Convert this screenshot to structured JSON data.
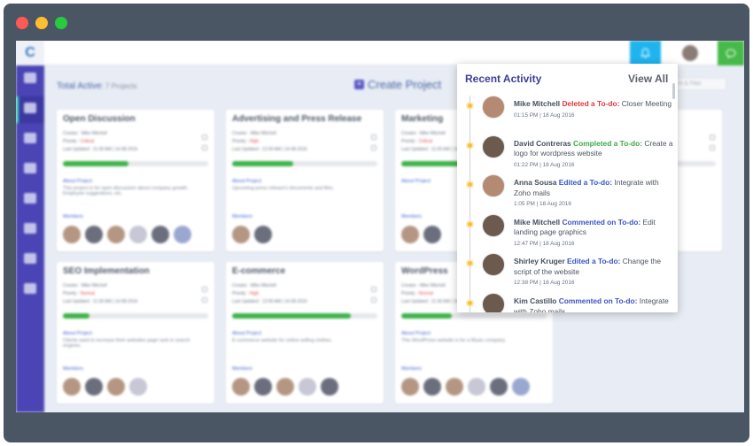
{
  "app": {
    "logo_text": "C",
    "subheading": "Total Active",
    "subcount": ": 7 Projects",
    "create_label": "Create Project",
    "search_placeholder": "Search & Filter"
  },
  "colors": {
    "sidebar": "#4a44b4",
    "accent_blue": "#1fb4ee",
    "accent_green": "#47b94a",
    "progress": "#3fb34a",
    "activity_title": "#3f3d9a",
    "deleted": "#e0383e",
    "completed": "#3da94d",
    "action": "#3a55c7"
  },
  "icons": {
    "bell": "bell-icon",
    "chat": "chat-icon",
    "sidebar": [
      "home-icon",
      "tasks-icon",
      "calendar-icon",
      "cloud-icon",
      "docs-icon",
      "shield-icon",
      "share-icon",
      "card-icon"
    ]
  },
  "cards": [
    {
      "title": "Open Discussion",
      "creator": "Creator : Mike Mitchell",
      "priority_label": "Priority :",
      "priority": "Critical",
      "updated": "Last Updated : 11:30 AM | 14-08-2016",
      "progress": 0.45,
      "about": "About Project",
      "desc": "This project is for open discussion about company growth. Employee suggestions, etc.",
      "members": "Members",
      "member_count": 6
    },
    {
      "title": "Advertising and Press Release",
      "creator": "Creator : Mike Mitchell",
      "priority_label": "Priority :",
      "priority": "High",
      "updated": "Last Updated : 12:00 AM | 14-08-2016",
      "progress": 0.42,
      "about": "About Project",
      "desc": "Upcoming press release's documents and files.",
      "members": "Members",
      "member_count": 2
    },
    {
      "title": "Marketing",
      "creator": "Creator : Mike Mitchell",
      "priority_label": "Priority :",
      "priority": "Critical",
      "updated": "Last Updated : 11:00 AM | 14-08-2016",
      "progress": 0.45,
      "about": "About Project",
      "desc": "",
      "members": "Members",
      "member_count": 2
    },
    {
      "title": "",
      "creator": "",
      "priority_label": "",
      "priority": "",
      "updated": "",
      "progress": 0.5,
      "about": "",
      "desc": "",
      "members": "",
      "member_count": 2
    },
    {
      "title": "SEO Implementation",
      "creator": "Creator : Mike Mitchell",
      "priority_label": "Priority :",
      "priority": "Normal",
      "updated": "Last Updated : 11:30 AM | 14-08-2016",
      "progress": 0.18,
      "about": "About Project",
      "desc": "Clients want to increase their websites page rank in search engines.",
      "members": "Members",
      "member_count": 4
    },
    {
      "title": "E-commerce",
      "creator": "Creator : Mike Mitchell",
      "priority_label": "Priority :",
      "priority": "High",
      "updated": "Last Updated : 12:00 AM | 14-08-2016",
      "progress": 0.82,
      "about": "About Project",
      "desc": "E-commerce website for online selling clothes.",
      "members": "Members",
      "member_count": 5
    },
    {
      "title": "WordPress",
      "creator": "Creator : Mike Mitchell",
      "priority_label": "Priority :",
      "priority": "Normal",
      "updated": "Last Updated : 11:30 AM | 14-08-2016",
      "progress": 0.35,
      "about": "About Project",
      "desc": "This WordPress website is for a Music company.",
      "members": "Members",
      "member_count": 6
    }
  ],
  "activity": {
    "title": "Recent Activity",
    "view_all": "View All",
    "items": [
      {
        "name": "Mike Mitchell",
        "action": "Deleted a To-do:",
        "type": "del",
        "text": "Closer Meeting",
        "time": "01:15 PM | 18 Aug 2016"
      },
      {
        "name": "David Contreras",
        "action": "Completed a To-do:",
        "type": "done",
        "text": "Create a logo for wordpress website",
        "time": "01:22 PM | 18 Aug 2016"
      },
      {
        "name": "Anna Sousa",
        "action": "Edited a To-do:",
        "type": "edit",
        "text": "Integrate with Zoho mails",
        "time": "1:05 PM | 18 Aug 2016"
      },
      {
        "name": "Mike Mitchell",
        "action": "Commented on To-do:",
        "type": "edit",
        "text": "Edit landing page graphics",
        "time": "12:47 PM | 18 Aug 2016"
      },
      {
        "name": "Shirley Kruger",
        "action": "Edited a To-do:",
        "type": "edit",
        "text": "Change the script of the website",
        "time": "12:38 PM | 18 Aug 2016"
      },
      {
        "name": "Kim Castillo",
        "action": "Commented on To-do:",
        "type": "edit",
        "text": "Integrate with Zoho mails",
        "time": ""
      }
    ]
  }
}
